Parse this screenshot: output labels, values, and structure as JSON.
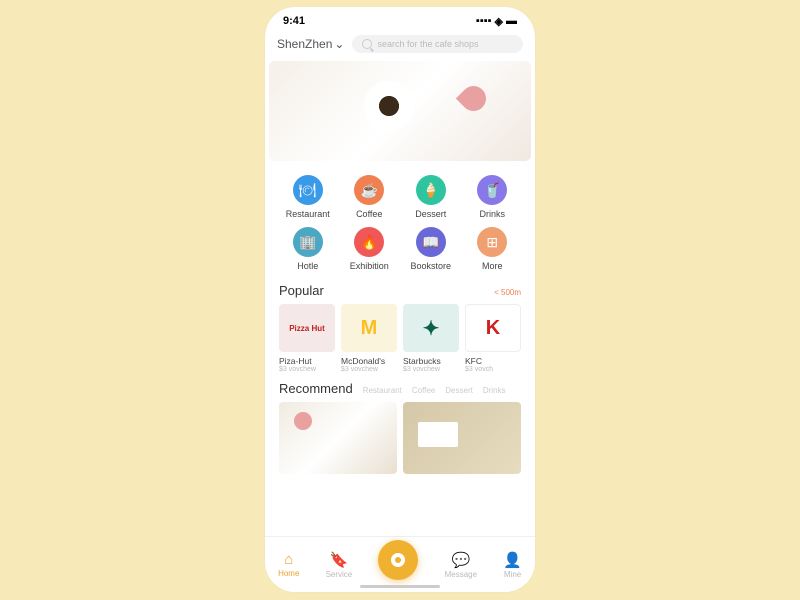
{
  "status": {
    "time": "9:41"
  },
  "header": {
    "location": "ShenZhen",
    "search_placeholder": "search for the cafe shops"
  },
  "categories": [
    {
      "label": "Restaurant",
      "color": "c-blue",
      "glyph": "🍽"
    },
    {
      "label": "Coffee",
      "color": "c-orange",
      "glyph": "☕"
    },
    {
      "label": "Dessert",
      "color": "c-teal",
      "glyph": "🍦"
    },
    {
      "label": "Drinks",
      "color": "c-purple",
      "glyph": "🥤"
    },
    {
      "label": "Hotle",
      "color": "c-bluegray",
      "glyph": "🏢"
    },
    {
      "label": "Exhibition",
      "color": "c-red",
      "glyph": "🔥"
    },
    {
      "label": "Bookstore",
      "color": "c-indigo",
      "glyph": "📖"
    },
    {
      "label": "More",
      "color": "c-peach",
      "glyph": "⊞"
    }
  ],
  "popular": {
    "title": "Popular",
    "distance": "< 500m",
    "items": [
      {
        "name": "Piza-Hut",
        "sub": "$3 vovchew",
        "logo": "Pizza Hut",
        "cls": "pizza"
      },
      {
        "name": "McDonald's",
        "sub": "$3 vovchew",
        "logo": "M",
        "cls": "mcd"
      },
      {
        "name": "Starbucks",
        "sub": "$3 vovchew",
        "logo": "✦",
        "cls": "sbux"
      },
      {
        "name": "KFC",
        "sub": "$3 vovch",
        "logo": "K",
        "cls": "kfc"
      }
    ]
  },
  "recommend": {
    "title": "Recommend",
    "filters": [
      "Restaurant",
      "Coffee",
      "Dessert",
      "Drinks"
    ]
  },
  "nav": [
    {
      "label": "Home",
      "icon": "⌂",
      "active": true
    },
    {
      "label": "Service",
      "icon": "🔖"
    },
    {
      "label": "Message",
      "icon": "💬"
    },
    {
      "label": "Mine",
      "icon": "👤"
    }
  ]
}
